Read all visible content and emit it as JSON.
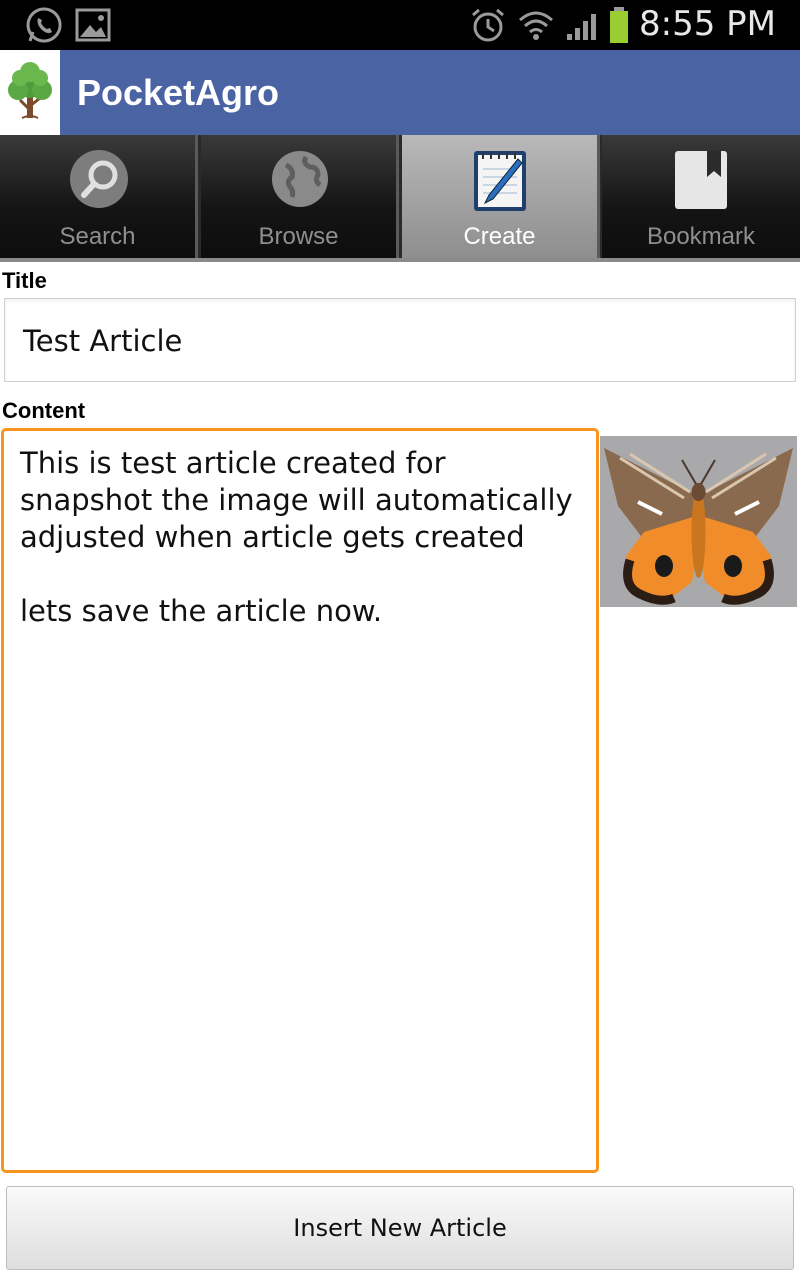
{
  "status_bar": {
    "time": "8:55 PM",
    "icons": [
      "whatsapp-icon",
      "gallery-icon",
      "alarm-icon",
      "wifi-icon",
      "signal-icon",
      "battery-icon"
    ]
  },
  "app": {
    "title": "PocketAgro",
    "logo": "tree-logo-icon",
    "header_color": "#4a63a2"
  },
  "tabs": [
    {
      "label": "Search",
      "icon": "search-magnifier-icon",
      "selected": false
    },
    {
      "label": "Browse",
      "icon": "globe-icon",
      "selected": false
    },
    {
      "label": "Create",
      "icon": "notepad-pen-icon",
      "selected": true
    },
    {
      "label": "Bookmark",
      "icon": "bookmark-icon",
      "selected": false
    }
  ],
  "form": {
    "title_label": "Title",
    "title_value": "Test Article",
    "content_label": "Content",
    "content_value": "This is test article created for snapshot the image will automatically adjusted when article gets created\n\nlets save the article now.",
    "focus_color": "#f7941e",
    "image": "moth-photo",
    "submit_label": "Insert New Article"
  }
}
